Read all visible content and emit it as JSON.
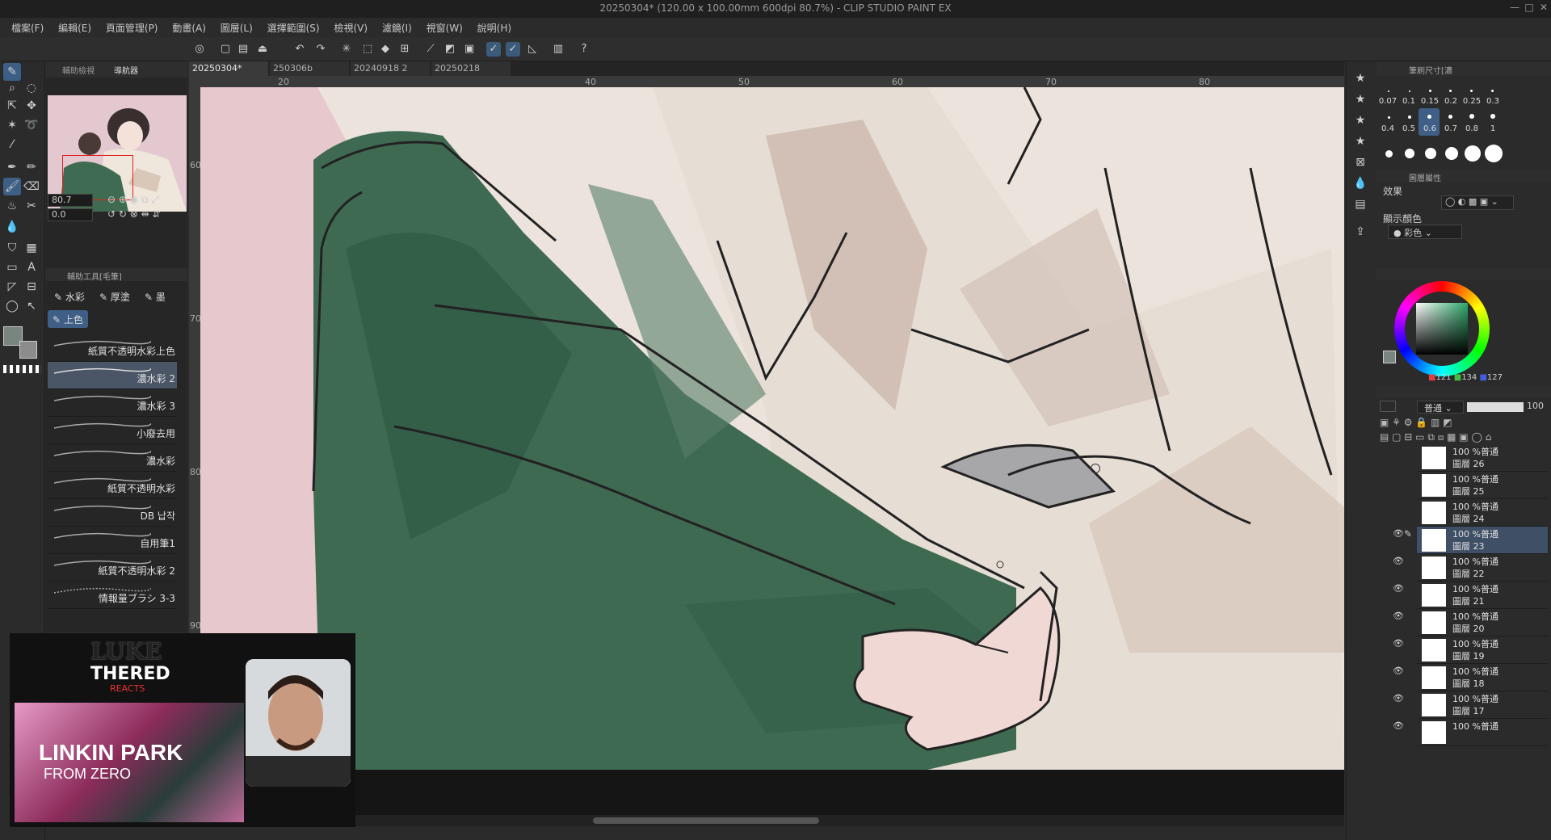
{
  "window": {
    "title": "20250304* (120.00 x 100.00mm 600dpi 80.7%) - CLIP STUDIO PAINT EX"
  },
  "menu": [
    "檔案(F)",
    "編輯(E)",
    "頁面管理(P)",
    "動畫(A)",
    "圖層(L)",
    "選擇範圍(S)",
    "檢視(V)",
    "濾鏡(I)",
    "視窗(W)",
    "說明(H)"
  ],
  "nav": {
    "tabs": [
      "輔助檢視",
      "導航器"
    ],
    "zoom": "80.7",
    "rotation": "0.0"
  },
  "subtool": {
    "header": "輔助工具[毛筆]",
    "groups": [
      "水彩",
      "厚塗",
      "墨"
    ],
    "active_group": "上色",
    "brushes": [
      "紙質不透明水彩上色",
      "濃水彩 2",
      "濃水彩 3",
      "小廢去用",
      "濃水彩",
      "紙質不透明水彩",
      "DB 납작",
      "自用筆1",
      "紙質不透明水彩 2",
      "情報量ブラシ 3-3"
    ]
  },
  "doc_tabs": [
    "20250304*",
    "250306b",
    "20240918 2",
    "20250218"
  ],
  "ruler": [
    "20",
    "40",
    "50",
    "60",
    "70",
    "80"
  ],
  "vruler": [
    "60",
    "70",
    "80",
    "90"
  ],
  "brush_size": {
    "header": "筆刷尺寸[濃",
    "sizes": [
      "0.07",
      "0.1",
      "0.15",
      "0.2",
      "0.25",
      "0.3",
      "0.4",
      "0.5",
      "0.6",
      "0.7",
      "0.8",
      "1"
    ],
    "selected": "0.6"
  },
  "layer_props": {
    "header": "圖層屬性",
    "effect_label": "效果",
    "color_label": "顯示顏色",
    "color_value": "彩色"
  },
  "color": {
    "r": "121",
    "g": "134",
    "b": "127",
    "current_hex": "#79867f"
  },
  "layers": {
    "blend_mode": "普通",
    "opacity": "100",
    "items": [
      {
        "meta": "100 %普通",
        "name": "圖層 26"
      },
      {
        "meta": "100 %普通",
        "name": "圖層 25"
      },
      {
        "meta": "100 %普通",
        "name": "圖層 24"
      },
      {
        "meta": "100 %普通",
        "name": "圖層 23"
      },
      {
        "meta": "100 %普通",
        "name": "圖層 22"
      },
      {
        "meta": "100 %普通",
        "name": "圖層 21"
      },
      {
        "meta": "100 %普通",
        "name": "圖層 20"
      },
      {
        "meta": "100 %普通",
        "name": "圖層 19"
      },
      {
        "meta": "100 %普通",
        "name": "圖層 18"
      },
      {
        "meta": "100 %普通",
        "name": "圖層 17"
      },
      {
        "meta": "100 %普通",
        "name": ""
      }
    ],
    "selected_index": 3
  },
  "stream": {
    "brand_top": "LUKE",
    "brand_mid": "THERED",
    "brand_sub": "REACTS",
    "video_title": "LINKIN PARK",
    "video_sub": "FROM ZERO"
  }
}
